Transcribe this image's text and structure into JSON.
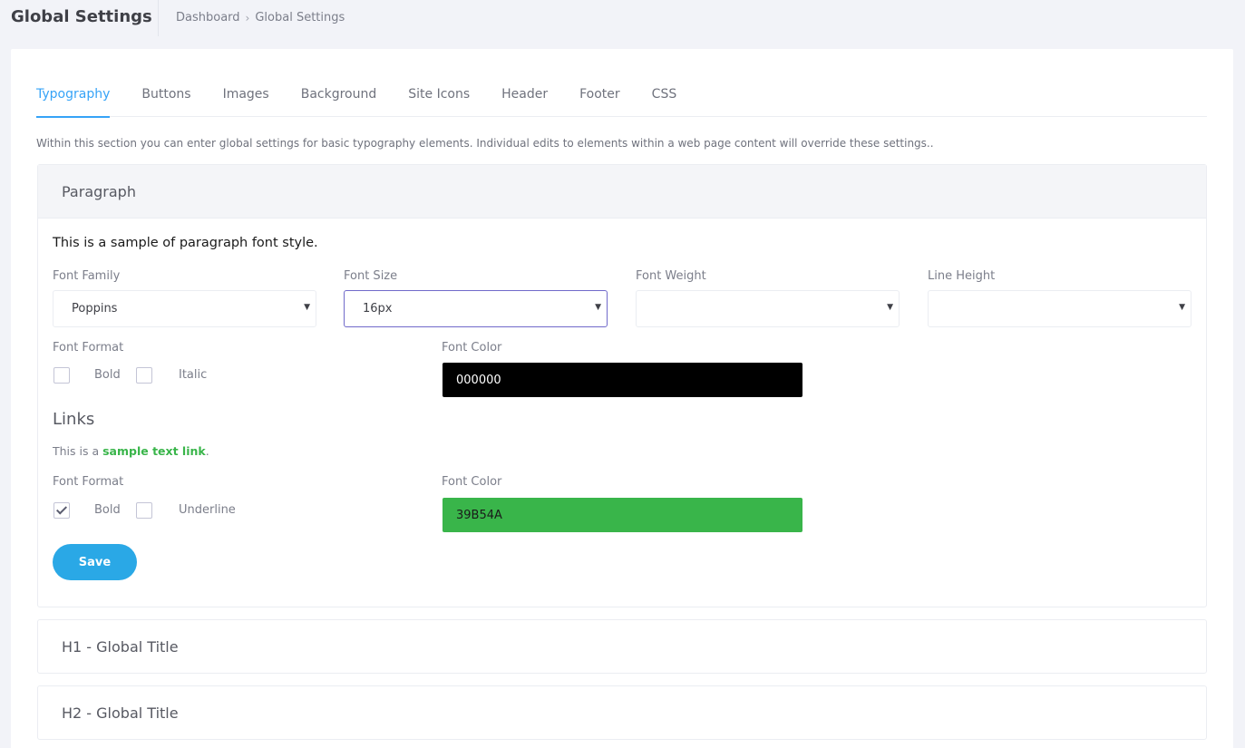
{
  "header": {
    "title": "Global Settings",
    "breadcrumb": [
      "Dashboard",
      "Global Settings"
    ],
    "breadcrumb_separator": "›"
  },
  "tabs": [
    {
      "label": "Typography",
      "active": true
    },
    {
      "label": "Buttons",
      "active": false
    },
    {
      "label": "Images",
      "active": false
    },
    {
      "label": "Background",
      "active": false
    },
    {
      "label": "Site Icons",
      "active": false
    },
    {
      "label": "Header",
      "active": false
    },
    {
      "label": "Footer",
      "active": false
    },
    {
      "label": "CSS",
      "active": false
    }
  ],
  "intro_text": "Within this section you can enter global settings for basic typography elements. Individual edits to elements within a web page content will override these settings..",
  "paragraph_panel": {
    "title": "Paragraph",
    "sample_text": "This is a sample of paragraph font style.",
    "font_family": {
      "label": "Font Family",
      "value": "Poppins"
    },
    "font_size": {
      "label": "Font Size",
      "value": "16px"
    },
    "font_weight": {
      "label": "Font Weight",
      "value": ""
    },
    "line_height": {
      "label": "Line Height",
      "value": ""
    },
    "font_format": {
      "label": "Font Format",
      "bold": {
        "label": "Bold",
        "checked": false
      },
      "italic": {
        "label": "Italic",
        "checked": false
      }
    },
    "font_color": {
      "label": "Font Color",
      "value": "000000",
      "swatch": "#000000"
    }
  },
  "links": {
    "title": "Links",
    "sample_prefix": "This is a ",
    "sample_link": "sample text link",
    "sample_suffix": ".",
    "font_format": {
      "label": "Font Format",
      "bold": {
        "label": "Bold",
        "checked": true
      },
      "underline": {
        "label": "Underline",
        "checked": false
      }
    },
    "font_color": {
      "label": "Font Color",
      "value": "39B54A",
      "swatch": "#39B54A"
    }
  },
  "save_label": "Save",
  "collapsed_panels": [
    {
      "title": "H1 - Global Title"
    },
    {
      "title": "H2 - Global Title"
    }
  ],
  "colors": {
    "accent": "#36a3f7",
    "save_button": "#2aa8e6",
    "link_green": "#39b54a"
  },
  "icons": {
    "select_arrow": "caret-down-icon",
    "breadcrumb_sep": "chevron-right-icon",
    "checkbox_tick": "checkmark-icon"
  }
}
